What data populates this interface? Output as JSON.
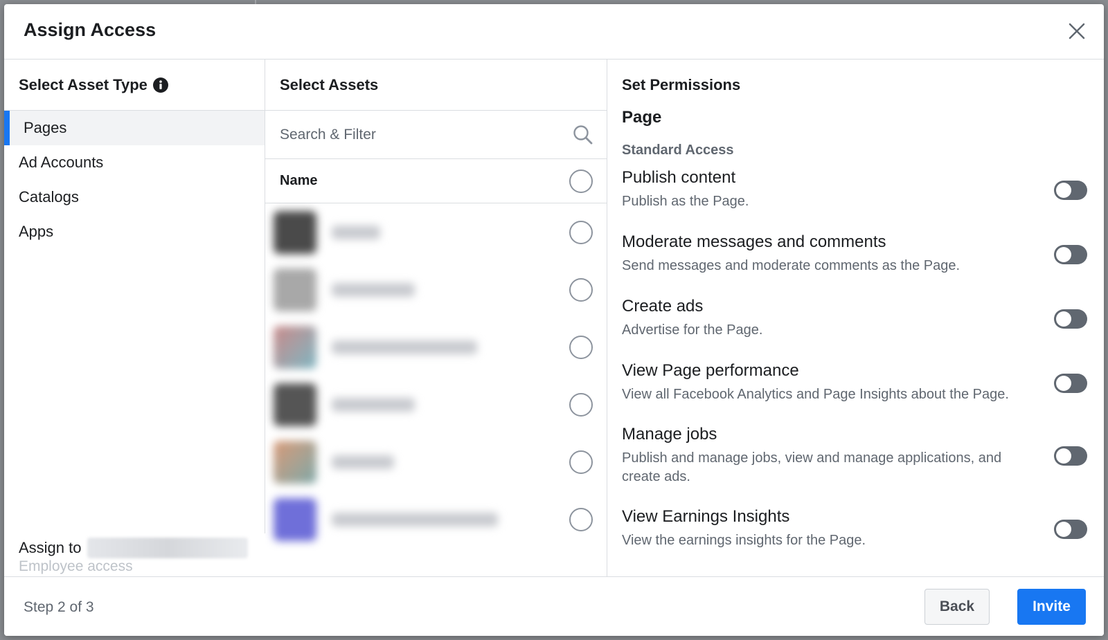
{
  "modal": {
    "title": "Assign Access"
  },
  "asset_types": {
    "heading": "Select Asset Type",
    "items": [
      {
        "label": "Pages",
        "active": true
      },
      {
        "label": "Ad Accounts",
        "active": false
      },
      {
        "label": "Catalogs",
        "active": false
      },
      {
        "label": "Apps",
        "active": false
      }
    ],
    "assign_label": "Assign to",
    "assign_subtext": "Employee access"
  },
  "assets": {
    "heading": "Select Assets",
    "search_placeholder": "Search & Filter",
    "name_header": "Name",
    "rows": [
      {
        "thumb": "#4a4a4a",
        "name_blur": "short"
      },
      {
        "thumb": "#a8a8a8",
        "name_blur": "medium"
      },
      {
        "thumb": "#b86a6a",
        "name_blur": "long"
      },
      {
        "thumb": "#555555",
        "name_blur": "medium"
      },
      {
        "thumb": "#c98a6a",
        "name_blur": "short"
      },
      {
        "thumb": "#6f6fd9",
        "name_blur": "long"
      }
    ]
  },
  "permissions": {
    "heading": "Set Permissions",
    "section": "Page",
    "subsection": "Standard Access",
    "items": [
      {
        "title": "Publish content",
        "desc": "Publish as the Page.",
        "enabled": false
      },
      {
        "title": "Moderate messages and comments",
        "desc": "Send messages and moderate comments as the Page.",
        "enabled": false
      },
      {
        "title": "Create ads",
        "desc": "Advertise for the Page.",
        "enabled": false
      },
      {
        "title": "View Page performance",
        "desc": "View all Facebook Analytics and Page Insights about the Page.",
        "enabled": false
      },
      {
        "title": "Manage jobs",
        "desc": "Publish and manage jobs, view and manage applications, and create ads.",
        "enabled": false
      },
      {
        "title": "View Earnings Insights",
        "desc": "View the earnings insights for the Page.",
        "enabled": false
      }
    ]
  },
  "footer": {
    "step_text": "Step 2 of 3",
    "back_label": "Back",
    "invite_label": "Invite"
  },
  "colors": {
    "accent": "#1877f2",
    "toggle_off": "#606770"
  }
}
